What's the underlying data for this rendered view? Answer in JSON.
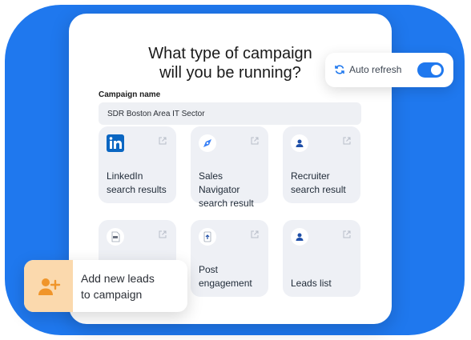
{
  "title": "What type of campaign\nwill you be running?",
  "campaign_name": {
    "label": "Campaign name",
    "value": "SDR Boston Area IT Sector"
  },
  "auto_refresh": {
    "label": "Auto refresh",
    "enabled": true,
    "icon": "refresh-icon"
  },
  "tiles": [
    {
      "label": "LinkedIn\nsearch results",
      "icon": "linkedin-icon"
    },
    {
      "label": "Sales Navigator\nsearch result",
      "icon": "compass-icon"
    },
    {
      "label": "Recruiter\nsearch result",
      "icon": "person-icon"
    },
    {
      "label": "",
      "icon": "csv-file-icon"
    },
    {
      "label": "Post\nengagement",
      "icon": "post-upload-icon"
    },
    {
      "label": "Leads list",
      "icon": "person-icon"
    }
  ],
  "add_leads": {
    "label": "Add new leads\nto campaign",
    "icon": "add-user-icon"
  },
  "colors": {
    "accent": "#1f78ee",
    "tile_bg": "#eef0f5",
    "badge_bg": "#fbd9ad",
    "badge_icon": "#f0952a"
  }
}
